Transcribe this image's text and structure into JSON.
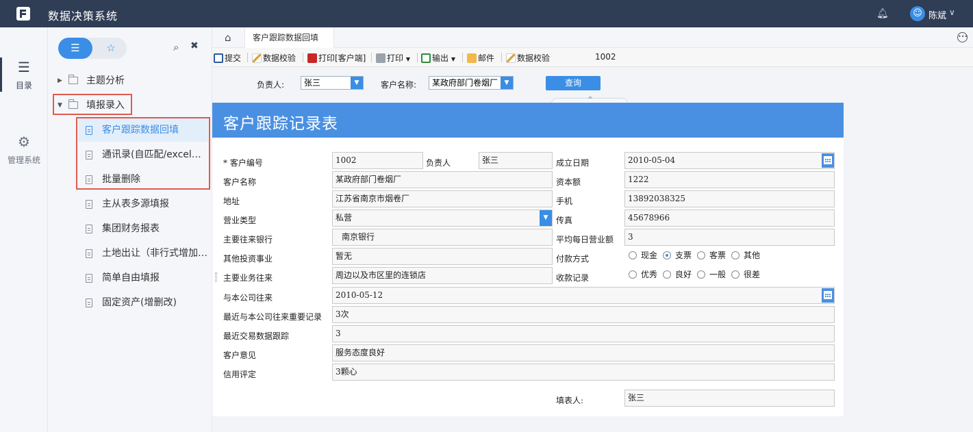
{
  "app": {
    "title": "数据决策系统",
    "user": "陈斌",
    "avatar_icon": "user-icon",
    "bell_icon": "bell-icon"
  },
  "rail": {
    "items": [
      {
        "label": "目录",
        "icon": "list-icon",
        "active": true
      },
      {
        "label": "管理系统",
        "icon": "gear-icon",
        "active": false
      }
    ]
  },
  "directory": {
    "tree": [
      {
        "label": "主题分析",
        "type": "folder",
        "expanded": false
      },
      {
        "label": "填报录入",
        "type": "folder",
        "expanded": true
      },
      {
        "label": "客户跟踪数据回填",
        "type": "doc",
        "selected": true
      },
      {
        "label": "通讯录(自匹配/excel在线编辑)",
        "display": "通讯录(自匹配/excel在…",
        "type": "doc"
      },
      {
        "label": "批量删除",
        "type": "doc"
      },
      {
        "label": "主从表多源填报",
        "type": "doc"
      },
      {
        "label": "集团财务报表",
        "type": "doc"
      },
      {
        "label": "土地出让（非行式增加…",
        "type": "doc"
      },
      {
        "label": "简单自由填报",
        "type": "doc"
      },
      {
        "label": "固定资产(增删改)",
        "type": "doc"
      }
    ]
  },
  "tabs": {
    "active": "客户跟踪数据回填"
  },
  "toolbar": {
    "submit": "提交",
    "validate1": "数据校验",
    "print_client": "打印[客户端]",
    "print": "打印",
    "export": "输出",
    "mail": "邮件",
    "validate2": "数据校验",
    "record_no": "1002"
  },
  "params": {
    "owner_label": "负责人:",
    "owner_value": "张三",
    "customer_label": "客户名称:",
    "customer_value": "某政府部门卷烟厂",
    "query": "查询"
  },
  "report": {
    "title": "客户跟踪记录表",
    "fields": {
      "cust_no_label": "* 客户编号",
      "cust_no": "1002",
      "owner_label": "负责人",
      "owner": "张三",
      "founded_label": "成立日期",
      "founded": "2010-05-04",
      "cust_name_label": "客户名称",
      "cust_name": "某政府部门卷烟厂",
      "capital_label": "资本额",
      "capital": "1222",
      "address_label": "地址",
      "address": "江苏省南京市烟卷厂",
      "mobile_label": "手机",
      "mobile": "13892038325",
      "biz_type_label": "营业类型",
      "biz_type": "私营",
      "fax_label": "传真",
      "fax": "45678966",
      "bank_label": "主要往来银行",
      "bank": "南京银行",
      "daily_label": "平均每日营业额",
      "daily": "3",
      "other_inv_label": "其他投资事业",
      "other_inv": "暂无",
      "pay_label": "付款方式",
      "main_biz_label": "主要业务往来",
      "main_biz": "周边以及市区里的连锁店",
      "collect_label": "收款记录",
      "since_label": "与本公司往来",
      "since": "2010-05-12",
      "recent_imp_label": "最近与本公司往来重要记录",
      "recent_imp": "3次",
      "recent_trade_label": "最近交易数据跟踪",
      "recent_trade": "3",
      "opinion_label": "客户意见",
      "opinion": "服务态度良好",
      "credit_label": "信用评定",
      "credit": "3颗心",
      "filler_label": "填表人:",
      "filler": "张三"
    },
    "pay_options": [
      {
        "label": "现金",
        "checked": false
      },
      {
        "label": "支票",
        "checked": true
      },
      {
        "label": "客票",
        "checked": false
      },
      {
        "label": "其他",
        "checked": false
      }
    ],
    "collect_options": [
      {
        "label": "优秀",
        "checked": false
      },
      {
        "label": "良好",
        "checked": false
      },
      {
        "label": "一般",
        "checked": false
      },
      {
        "label": "很差",
        "checked": false
      }
    ]
  },
  "colors": {
    "topbar": "#2f3d55",
    "accent": "#3a8ee6",
    "report_header": "#4a90e2",
    "highlight": "#e05a4f"
  }
}
